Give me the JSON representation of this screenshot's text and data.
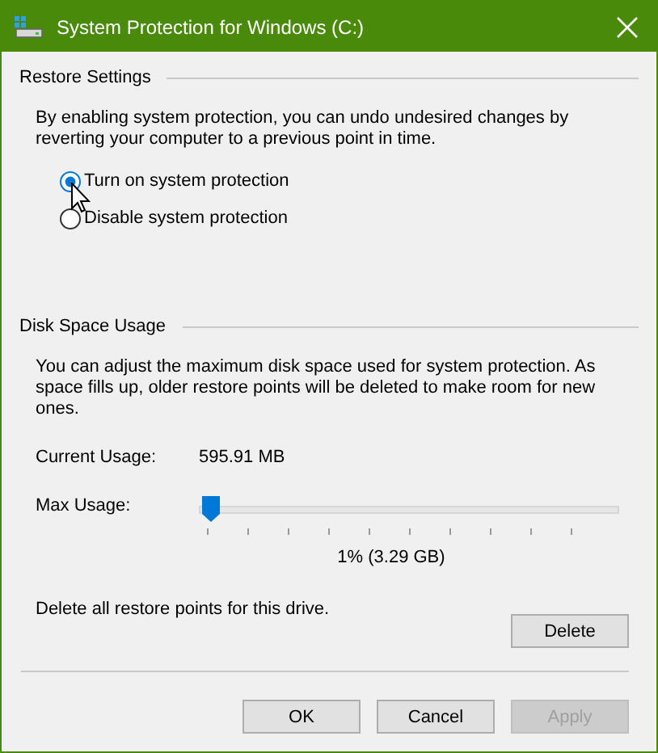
{
  "window": {
    "title": "System Protection for Windows (C:)"
  },
  "restore_settings": {
    "heading": "Restore Settings",
    "description": "By enabling system protection, you can undo undesired changes by reverting your computer to a previous point in time.",
    "options": [
      {
        "label": "Turn on system protection",
        "selected": true
      },
      {
        "label": "Disable system protection",
        "selected": false
      }
    ]
  },
  "disk_space_usage": {
    "heading": "Disk Space Usage",
    "description": "You can adjust the maximum disk space used for system protection. As space fills up, older restore points will be deleted to make room for new ones.",
    "current_usage": {
      "label": "Current Usage:",
      "value": "595.91 MB"
    },
    "max_usage": {
      "label": "Max Usage:",
      "level": 0.01,
      "reading": "1% (3.29 GB)"
    },
    "delete_text": "Delete all restore points for this drive.",
    "delete_button": "Delete"
  },
  "buttons": [
    {
      "label": "OK",
      "disabled": false
    },
    {
      "label": "Cancel",
      "disabled": false
    },
    {
      "label": "Apply",
      "disabled": true
    }
  ]
}
